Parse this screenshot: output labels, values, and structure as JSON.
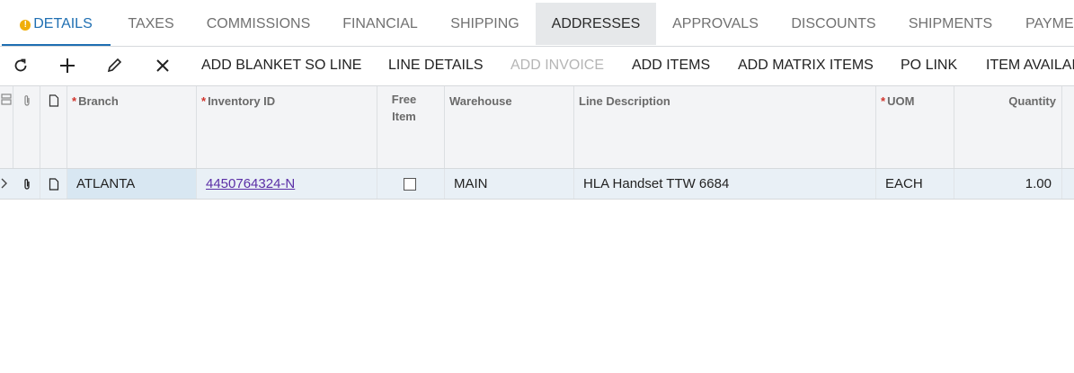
{
  "tabs": [
    {
      "label": "DETAILS"
    },
    {
      "label": "TAXES"
    },
    {
      "label": "COMMISSIONS"
    },
    {
      "label": "FINANCIAL"
    },
    {
      "label": "SHIPPING"
    },
    {
      "label": "ADDRESSES"
    },
    {
      "label": "APPROVALS"
    },
    {
      "label": "DISCOUNTS"
    },
    {
      "label": "SHIPMENTS"
    },
    {
      "label": "PAYMEN"
    }
  ],
  "toolbar": {
    "icons": [
      "refresh-icon",
      "add-icon",
      "edit-icon",
      "delete-icon"
    ],
    "buttons": [
      {
        "label": "ADD BLANKET SO LINE"
      },
      {
        "label": "LINE DETAILS"
      },
      {
        "label": "ADD INVOICE"
      },
      {
        "label": "ADD ITEMS"
      },
      {
        "label": "ADD MATRIX ITEMS"
      },
      {
        "label": "PO LINK"
      },
      {
        "label": "ITEM AVAILAB"
      }
    ]
  },
  "grid": {
    "headers": {
      "branch": "Branch",
      "inventory_id": "Inventory ID",
      "free_item": "Free Item",
      "warehouse": "Warehouse",
      "line_description": "Line Description",
      "uom": "UOM",
      "quantity": "Quantity"
    },
    "rows": [
      {
        "branch": "ATLANTA",
        "inventory_id": "4450764324-N",
        "free_item": false,
        "warehouse": "MAIN",
        "line_description": "HLA Handset TTW 6684",
        "uom": "EACH",
        "quantity": "1.00"
      }
    ]
  },
  "colors": {
    "accent": "#1f6fb2",
    "required": "#d0342c",
    "link": "#5a2ea6",
    "warning": "#f0ae0a"
  }
}
